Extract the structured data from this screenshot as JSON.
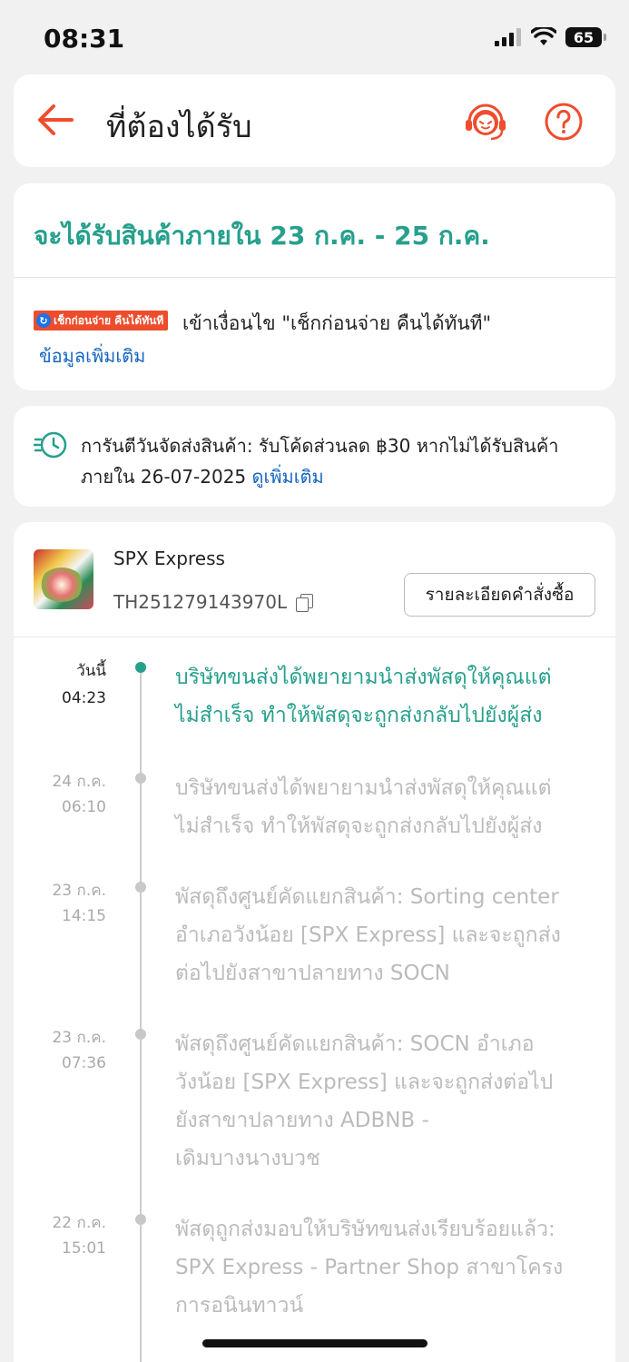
{
  "status_bar": {
    "time": "08:31",
    "battery": "65"
  },
  "header": {
    "title": "ที่ต้องได้รับ"
  },
  "delivery": {
    "estimate": "จะได้รับสินค้าภายใน 23 ก.ค. - 25 ก.ค.",
    "badge_text": "เช็กก่อนจ่าย คืนได้ทันที",
    "promo_text": "เข้าเงื่อนไข \"เช็กก่อนจ่าย คืนได้ทันที\"",
    "more_link": "ข้อมูลเพิ่มเติม"
  },
  "guarantee": {
    "line1": "การันตีวันจัดส่งสินค้า: รับโค้ดส่วนลด ฿30 หากไม่ได้รับสินค้า",
    "line2": "ภายใน 26-07-2025",
    "link": "ดูเพิ่มเติม"
  },
  "shipment": {
    "carrier": "SPX Express",
    "tracking_number": "TH251279143970L",
    "order_details_button": "รายละเอียดคำสั่งซื้อ"
  },
  "timeline": [
    {
      "date": "วันนี้",
      "time": "04:23",
      "lines": [
        "บริษัทขนส่งได้พยายามนำส่งพัสดุให้คุณแต่",
        "ไม่สำเร็จ ทำให้พัสดุจะถูกส่งกลับไปยังผู้ส่ง"
      ]
    },
    {
      "date": "24 ก.ค.",
      "time": "06:10",
      "lines": [
        "บริษัทขนส่งได้พยายามนำส่งพัสดุให้คุณแต่",
        "ไม่สำเร็จ ทำให้พัสดุจะถูกส่งกลับไปยังผู้ส่ง"
      ]
    },
    {
      "date": "23 ก.ค.",
      "time": "14:15",
      "lines": [
        "พัสดุถึงศูนย์คัดแยกสินค้า: Sorting center",
        "อำเภอวังน้อย [SPX Express] และจะถูกส่ง",
        "ต่อไปยังสาขาปลายทาง SOCN"
      ]
    },
    {
      "date": "23 ก.ค.",
      "time": "07:36",
      "lines": [
        "พัสดุถึงศูนย์คัดแยกสินค้า: SOCN อำเภอ",
        "วังน้อย [SPX Express] และจะถูกส่งต่อไป",
        "ยังสาขาปลายทาง ADBNB -",
        "เดิมบางนางบวช"
      ]
    },
    {
      "date": "22 ก.ค.",
      "time": "15:01",
      "lines": [
        "พัสดุถูกส่งมอบให้บริษัทขนส่งเรียบร้อยแล้ว:",
        "SPX Express - Partner Shop สาขาโครง",
        "การอนินทาวน์"
      ]
    }
  ],
  "colors": {
    "accent": "#ee4d2d",
    "success": "#26a08c",
    "link": "#1565c0"
  }
}
